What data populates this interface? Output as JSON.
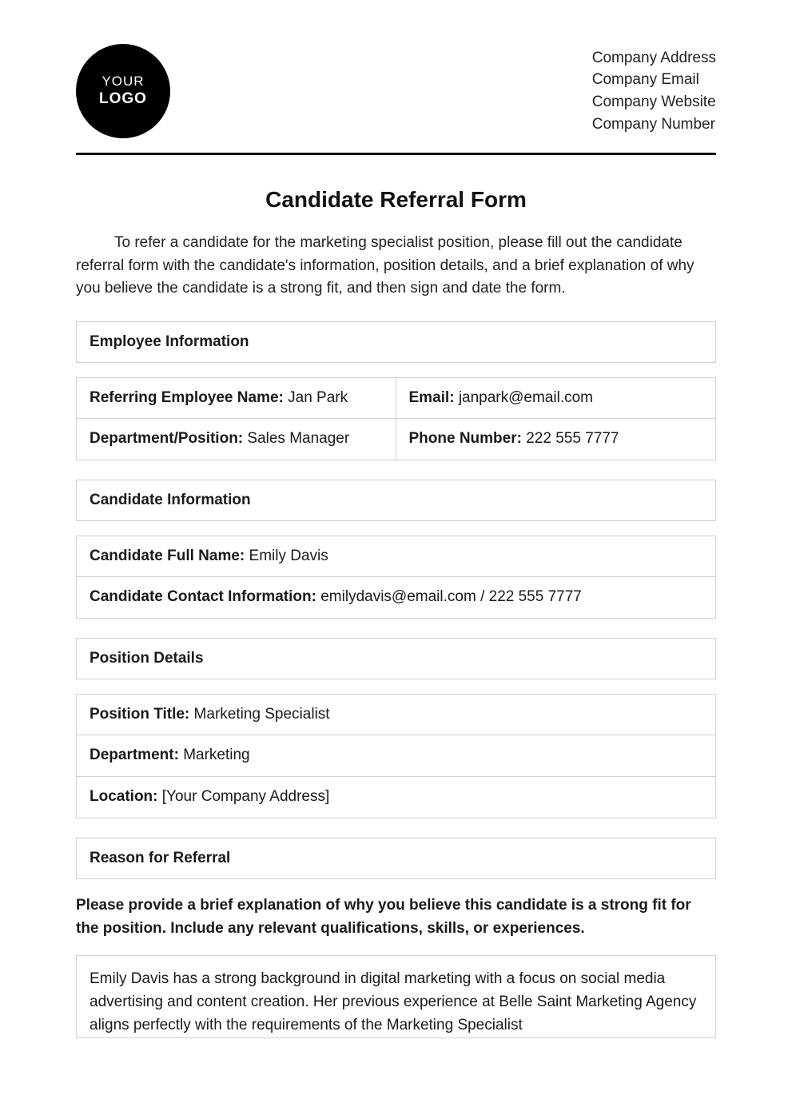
{
  "logo": {
    "line1": "YOUR",
    "line2": "LOGO"
  },
  "company": {
    "address": "Company Address",
    "email": "Company Email",
    "website": "Company Website",
    "number": "Company Number"
  },
  "title": "Candidate Referral Form",
  "intro": "To refer a candidate for the marketing specialist position, please fill out the candidate referral form with the candidate's information, position details, and a brief explanation of why you believe the candidate is a strong fit, and then sign and date the form.",
  "sections": {
    "employee": {
      "heading": "Employee Information",
      "fields": {
        "name_label": "Referring Employee Name:",
        "name_value": "Jan Park",
        "email_label": "Email:",
        "email_value": "janpark@email.com",
        "dept_label": "Department/Position:",
        "dept_value": "Sales Manager",
        "phone_label": "Phone Number:",
        "phone_value": "222 555 7777"
      }
    },
    "candidate": {
      "heading": "Candidate Information",
      "fields": {
        "name_label": "Candidate Full Name:",
        "name_value": "Emily Davis",
        "contact_label": "Candidate Contact Information:",
        "contact_value": "emilydavis@email.com / 222 555 7777"
      }
    },
    "position": {
      "heading": "Position Details",
      "fields": {
        "title_label": "Position Title:",
        "title_value": "Marketing Specialist",
        "dept_label": "Department:",
        "dept_value": "Marketing",
        "loc_label": "Location:",
        "loc_value": "[Your Company Address]"
      }
    },
    "reason": {
      "heading": "Reason for Referral",
      "prompt": "Please provide a brief explanation of why you believe this candidate is a strong fit for the position. Include any relevant qualifications, skills, or experiences.",
      "text": "Emily Davis has a strong background in digital marketing with a focus on social media advertising and content creation. Her previous experience at Belle Saint Marketing Agency aligns perfectly with the requirements of the Marketing Specialist"
    }
  }
}
